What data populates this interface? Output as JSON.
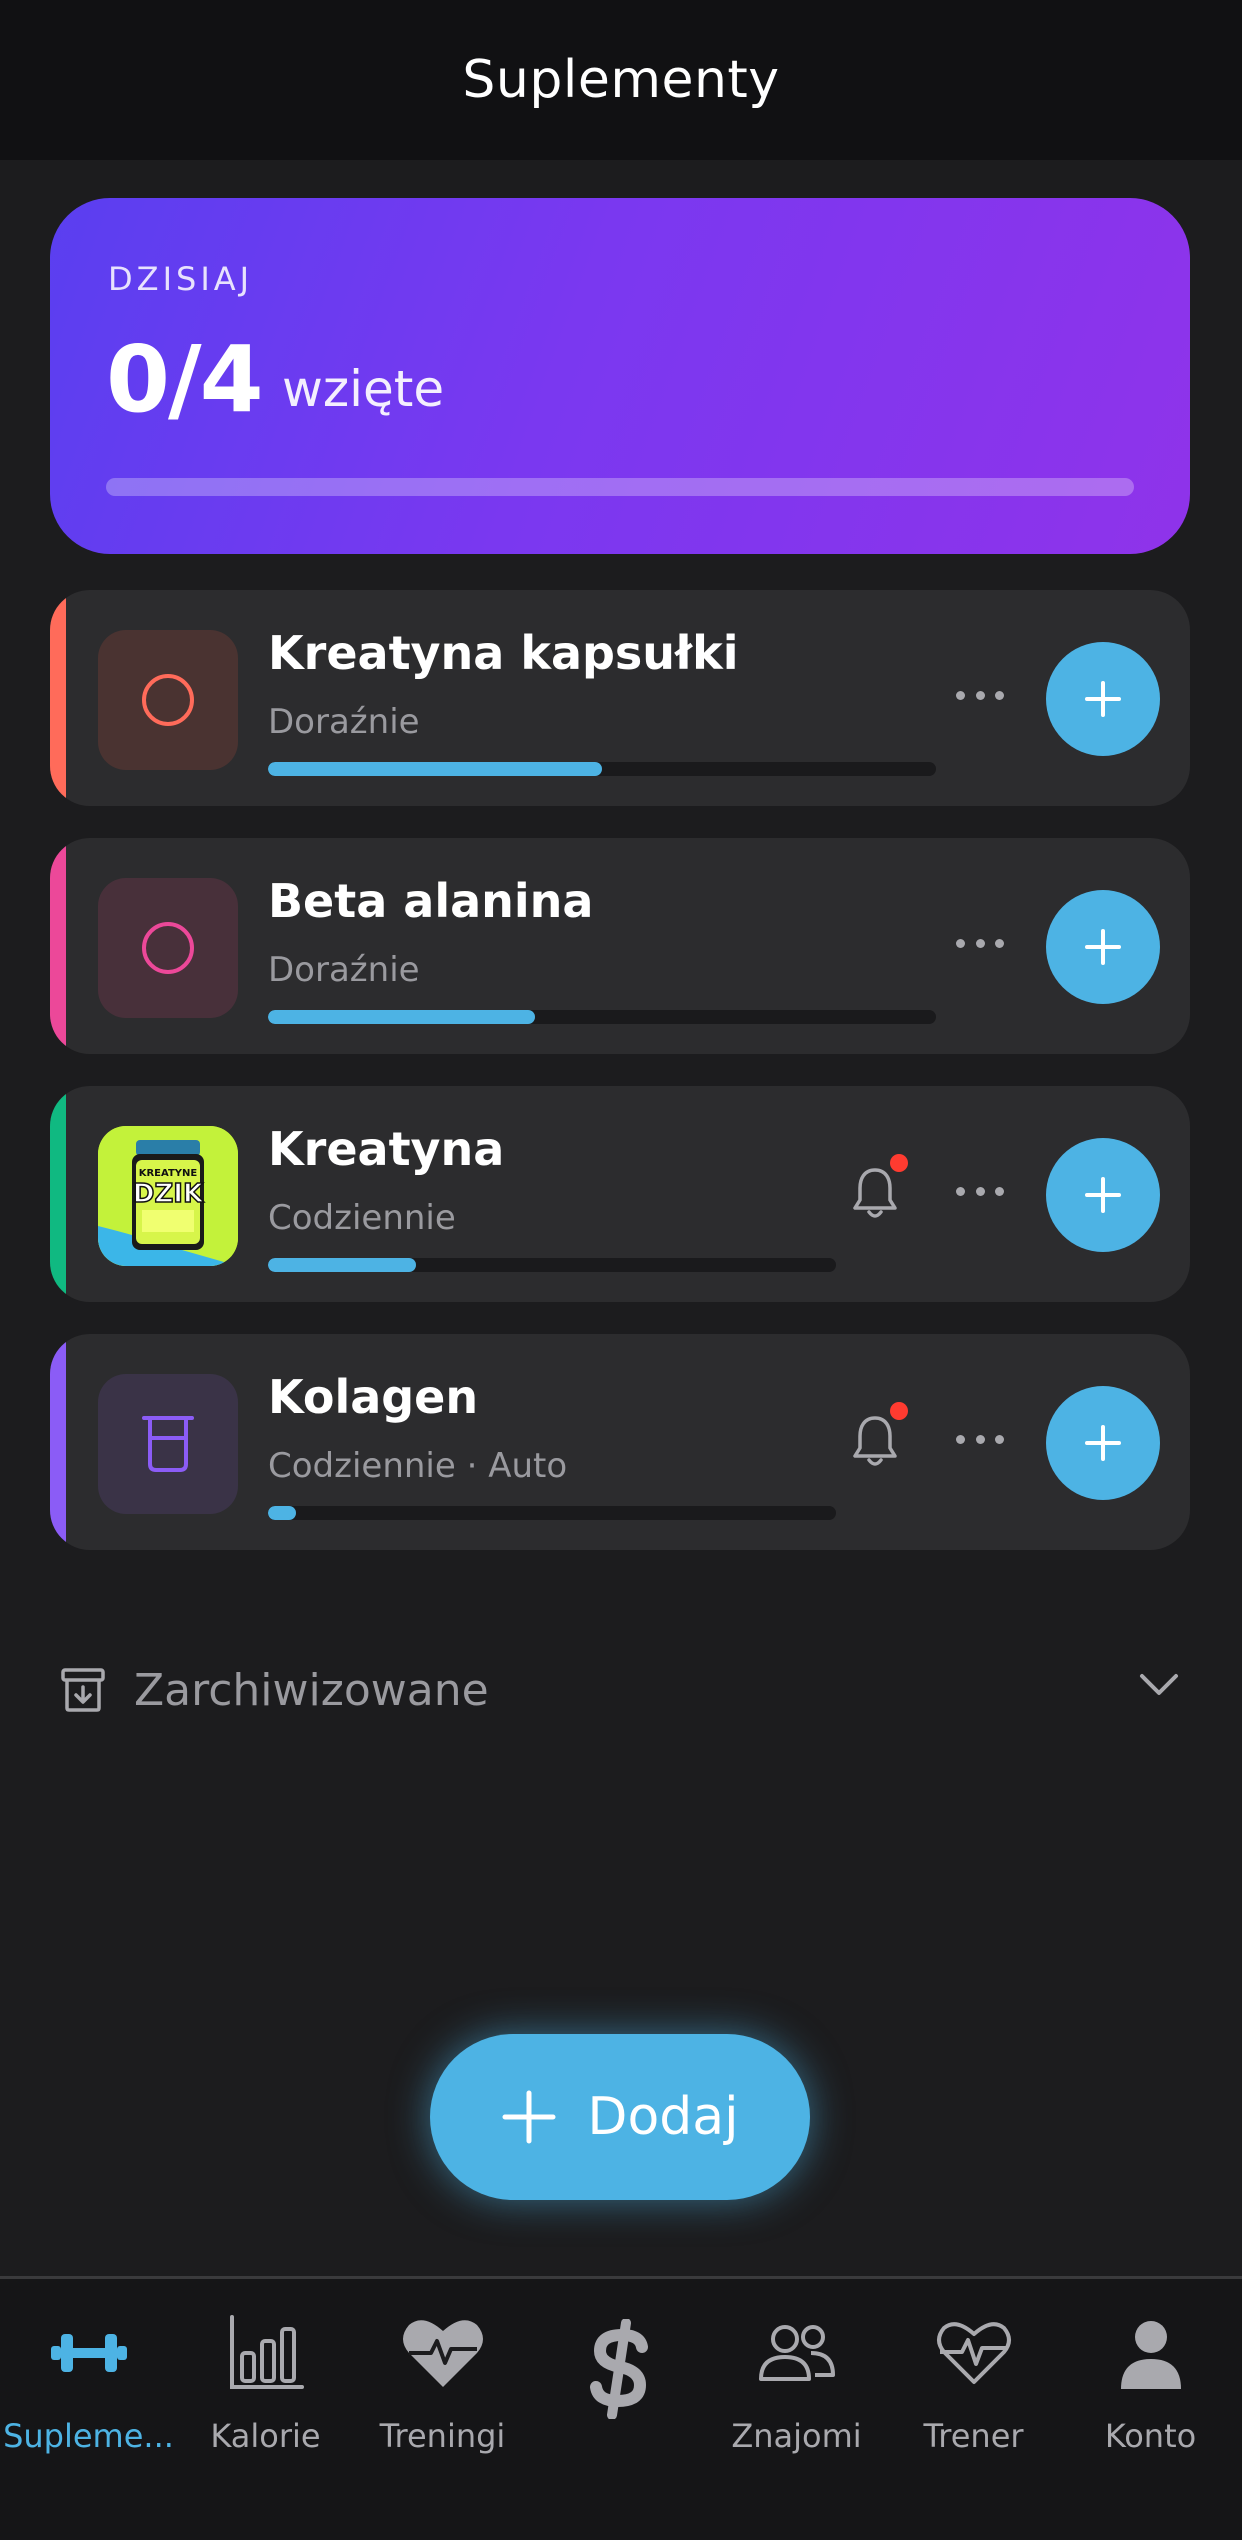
{
  "header": {
    "title": "Suplementy"
  },
  "today": {
    "label": "DZISIAJ",
    "count": "0/4",
    "suffix": "wzięte",
    "progress": 0
  },
  "supplements": [
    {
      "name": "Kreatyna kapsułki",
      "subtitle": "Doraźnie",
      "accent": "#ff6b5a",
      "icon": "circle-icon",
      "progress": 0.5,
      "reminder": false
    },
    {
      "name": "Beta alanina",
      "subtitle": "Doraźnie",
      "accent": "#ec4899",
      "icon": "circle-icon",
      "progress": 0.4,
      "reminder": false
    },
    {
      "name": "Kreatyna",
      "subtitle": "Codziennie",
      "accent": "#10b981",
      "icon": "product-photo",
      "progress": 0.26,
      "reminder": true
    },
    {
      "name": "Kolagen",
      "subtitle": "Codziennie · Auto",
      "accent": "#8b5cf6",
      "icon": "beaker-icon",
      "progress": 0.05,
      "reminder": true
    }
  ],
  "product_image_text": {
    "line1": "KREATYNE",
    "brand": "DZIK"
  },
  "archived": {
    "label": "Zarchiwizowane"
  },
  "fab": {
    "label": "Dodaj"
  },
  "tabs": [
    {
      "label": "Supleme...",
      "icon": "dumbbell-icon",
      "active": true
    },
    {
      "label": "Kalorie",
      "icon": "bar-chart-icon",
      "active": false
    },
    {
      "label": "Treningi",
      "icon": "heart-pulse-icon",
      "active": false
    },
    {
      "label": "",
      "icon": "dollar-logo-icon",
      "active": false
    },
    {
      "label": "Znajomi",
      "icon": "friends-icon",
      "active": false
    },
    {
      "label": "Trener",
      "icon": "heart-outline-pulse-icon",
      "active": false
    },
    {
      "label": "Konto",
      "icon": "person-icon",
      "active": false
    }
  ],
  "colors": {
    "accent": "#4db3e4",
    "background": "#1c1c1e",
    "card": "#2c2c2e",
    "badge": "#ff3b30"
  }
}
